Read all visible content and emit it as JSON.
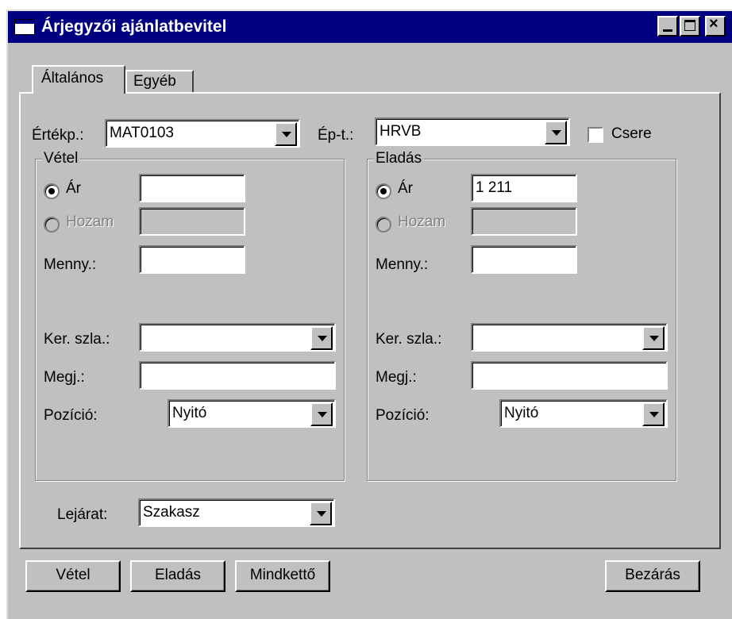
{
  "window": {
    "title": "Árjegyzői ajánlatbevitel"
  },
  "tabs": [
    {
      "label": "Általános"
    },
    {
      "label": "Egyéb"
    }
  ],
  "top": {
    "ertekp_label": "Értékp.:",
    "ertekp_value": "MAT0103",
    "ept_label": "Ép-t.:",
    "ept_value": "HRVB",
    "csere_label": "Csere",
    "csere_checked": false
  },
  "vetel": {
    "group_title": "Vétel",
    "ar_label": "Ár",
    "ar_value": "",
    "hozam_label": "Hozam",
    "hozam_value": "",
    "menny_label": "Menny.:",
    "menny_value": "",
    "kerszla_label": "Ker. szla.:",
    "kerszla_value": "",
    "megj_label": "Megj.:",
    "megj_value": "",
    "pozicio_label": "Pozíció:",
    "pozicio_value": "Nyitó"
  },
  "eladas": {
    "group_title": "Eladás",
    "ar_label": "Ár",
    "ar_value": "1 211",
    "hozam_label": "Hozam",
    "hozam_value": "",
    "menny_label": "Menny.:",
    "menny_value": "",
    "kerszla_label": "Ker. szla.:",
    "kerszla_value": "",
    "megj_label": "Megj.:",
    "megj_value": "",
    "pozicio_label": "Pozíció:",
    "pozicio_value": "Nyitó"
  },
  "lejarat": {
    "label": "Lejárat:",
    "value": "Szakasz"
  },
  "buttons": {
    "vetel": "Vétel",
    "eladas": "Eladás",
    "mindketto": "Mindkettő",
    "bezaras": "Bezárás"
  },
  "colors": {
    "titlebar": "#000080",
    "face": "#c0c0c0"
  }
}
